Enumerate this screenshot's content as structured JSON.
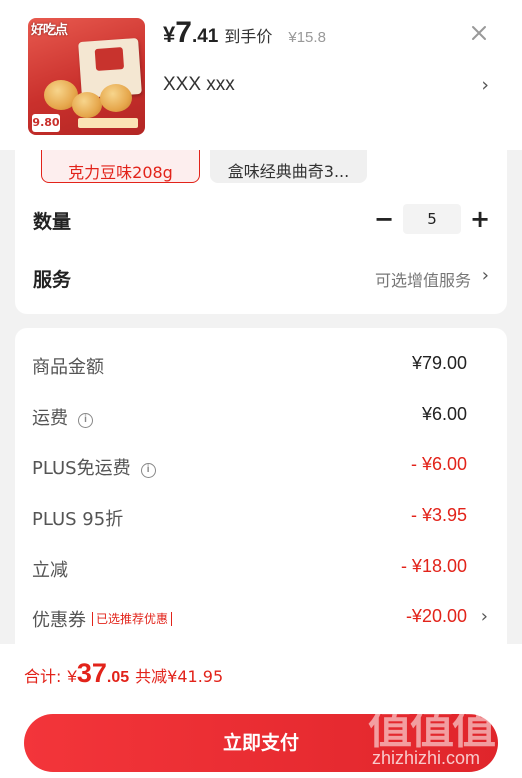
{
  "product": {
    "brand_logo_text": "好吃点",
    "thumb_price_tag": "9.80",
    "price_currency": "¥",
    "price_int": "7",
    "price_dec": ".41",
    "price_label": "到手价",
    "original_price": "¥15.8",
    "variant_text": "XXX  xxx",
    "close_icon": "close-icon",
    "chevron": "›"
  },
  "specs": {
    "options": [
      {
        "line1": "【",
        "line2": "克力豆味208g",
        "selected": true
      },
      {
        "line1": "【",
        "line2": "盒味经典曲奇3...",
        "selected": false
      }
    ],
    "quantity_label": "数量",
    "quantity_minus": "−",
    "quantity_value": "5",
    "quantity_plus": "+",
    "service_label": "服务",
    "service_value": "可选增值服务",
    "chevron": "›"
  },
  "summary": {
    "rows": [
      {
        "label": "商品金额",
        "value": "¥79.00",
        "tone": "dark",
        "info": false
      },
      {
        "label": "运费",
        "value": "¥6.00",
        "tone": "dark",
        "info": true
      },
      {
        "label": "PLUS免运费",
        "value": "- ¥6.00",
        "tone": "red",
        "info": true
      },
      {
        "label": "PLUS 95折",
        "value": "- ¥3.95",
        "tone": "red",
        "info": false
      },
      {
        "label": "立减",
        "value": "- ¥18.00",
        "tone": "red",
        "info": false
      },
      {
        "label": "优惠券",
        "value": "-¥20.00",
        "tone": "red",
        "info": false,
        "badge": "已选推荐优惠"
      }
    ],
    "info_glyph": "i",
    "chevron": "›"
  },
  "footer": {
    "total_label": "合计:",
    "total_currency": "¥",
    "total_int": "37",
    "total_dec": ".05",
    "saved_text": "共减¥41.95",
    "pay_button": "立即支付"
  },
  "watermark": {
    "glyphs": "值值值",
    "domain": "zhizhizhi.com"
  },
  "colors": {
    "accent_red": "#e2231a",
    "pay_button": "#f3353a",
    "background": "#f2f2f2"
  }
}
